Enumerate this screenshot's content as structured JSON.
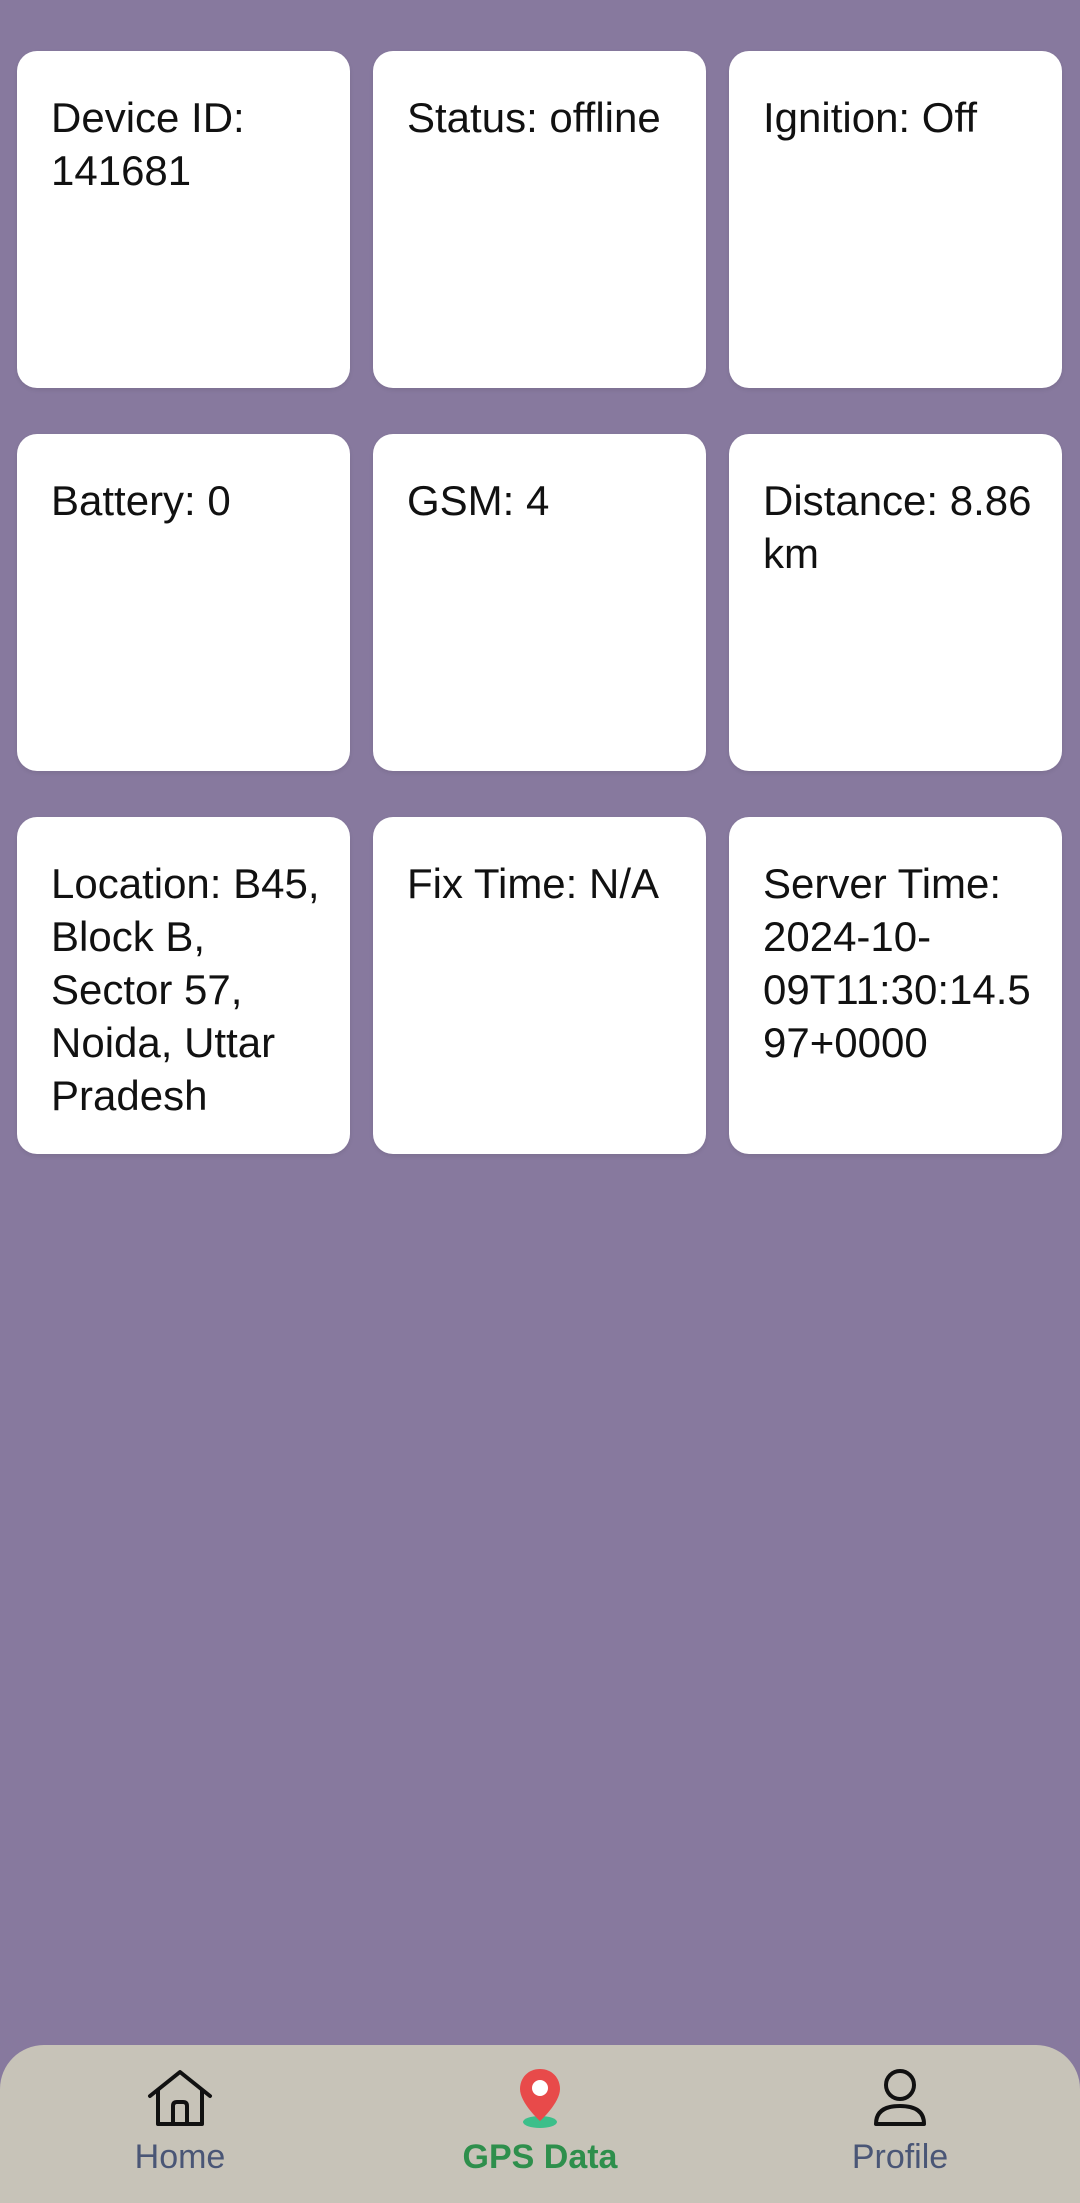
{
  "cards": [
    {
      "text": "Device ID: 141681"
    },
    {
      "text": "Status: offline"
    },
    {
      "text": "Ignition: Off"
    },
    {
      "text": "Battery: 0"
    },
    {
      "text": "GSM: 4"
    },
    {
      "text": "Distance: 8.86 km"
    },
    {
      "text": "Location: B45, Block B, Sector 57, Noida, Uttar Pradesh"
    },
    {
      "text": "Fix Time: N/A"
    },
    {
      "text": "Server Time: 2024-10-09T11:30:14.597+0000"
    }
  ],
  "nav": {
    "items": [
      {
        "label": "Home",
        "icon": "home-icon"
      },
      {
        "label": "GPS Data",
        "icon": "map-pin-icon",
        "active": true
      },
      {
        "label": "Profile",
        "icon": "person-icon"
      }
    ]
  },
  "colors": {
    "background": "#87799e",
    "card": "#ffffff",
    "nav_bar": "#c7c3b8",
    "active": "#2e8f4c",
    "inactive": "#4a5676",
    "pin": "#e84a4a",
    "pin_shadow": "#3bbf8a"
  }
}
